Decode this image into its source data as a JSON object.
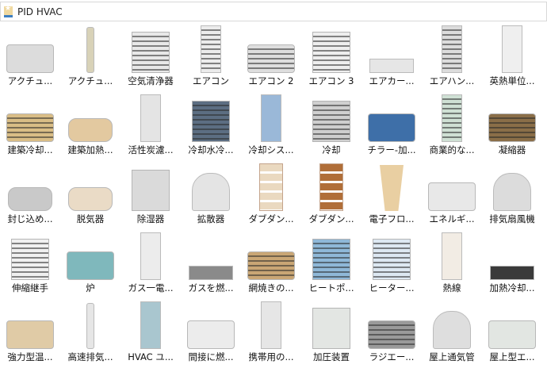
{
  "panel": {
    "title": "PID HVAC",
    "icon": "library-star-icon"
  },
  "items": [
    {
      "label": "アクチュ...",
      "icon": "actuator-icon",
      "shape": "wide",
      "color": "#dcdcdc"
    },
    {
      "label": "アクチュ...",
      "icon": "actuator-rod-icon",
      "shape": "thin",
      "color": "#d8d2b8"
    },
    {
      "label": "空気清浄器",
      "icon": "air-purifier-icon",
      "shape": "square",
      "color": "#e8e8e8",
      "stripes": true
    },
    {
      "label": "エアコン",
      "icon": "air-conditioner-tower-icon",
      "shape": "tall",
      "color": "#ececec",
      "stripes": true
    },
    {
      "label": "エアコン 2",
      "icon": "window-air-conditioner-icon",
      "shape": "wide",
      "color": "#dedede",
      "stripes": true
    },
    {
      "label": "エアコン 3",
      "icon": "wall-air-conditioner-icon",
      "shape": "square",
      "color": "#eeeeee",
      "stripes": true
    },
    {
      "label": "エアカー...",
      "icon": "air-curtain-icon",
      "shape": "strip",
      "color": "#e6e6e6"
    },
    {
      "label": "エアハン...",
      "icon": "air-handler-icon",
      "shape": "tall",
      "color": "#dcdcdc",
      "stripes": true
    },
    {
      "label": "英熱単位...",
      "icon": "btu-meter-icon",
      "shape": "tall",
      "color": "#efefef"
    },
    {
      "label": "建築冷却...",
      "icon": "building-cooling-icon",
      "shape": "wide",
      "color": "#d9bd86",
      "stripes": true
    },
    {
      "label": "建築加熱...",
      "icon": "building-heating-icon",
      "shape": "cyl",
      "color": "#e3c9a0"
    },
    {
      "label": "活性炭濾...",
      "icon": "carbon-filter-icon",
      "shape": "tall",
      "color": "#e4e4e4"
    },
    {
      "label": "冷却水冷...",
      "icon": "chilled-water-coil-icon",
      "shape": "square",
      "color": "#5c6e82",
      "stripes": true
    },
    {
      "label": "冷却シス...",
      "icon": "cooling-system-icon",
      "shape": "tall",
      "color": "#9ab8d8"
    },
    {
      "label": "冷却",
      "icon": "cooling-unit-icon",
      "shape": "square",
      "color": "#cfcfcf",
      "stripes": true
    },
    {
      "label": "チラー-加...",
      "icon": "chiller-icon",
      "shape": "wide",
      "color": "#3e6fa8"
    },
    {
      "label": "商業的な...",
      "icon": "commercial-unit-icon",
      "shape": "tall",
      "color": "#cfe0d4",
      "stripes": true
    },
    {
      "label": "凝縮器",
      "icon": "condenser-icon",
      "shape": "wide",
      "color": "#8a6e48",
      "stripes": true
    },
    {
      "label": "封じ込め...",
      "icon": "containment-icon",
      "shape": "cyl",
      "color": "#c9c9c9"
    },
    {
      "label": "脱気器",
      "icon": "deaerator-icon",
      "shape": "cyl",
      "color": "#eadbc6"
    },
    {
      "label": "除湿器",
      "icon": "dehumidifier-icon",
      "shape": "square",
      "color": "#dadada"
    },
    {
      "label": "拡散器",
      "icon": "diffuser-icon",
      "shape": "dome",
      "color": "#e4e4e4"
    },
    {
      "label": "ダブダン...",
      "icon": "damper-light-icon",
      "shape": "panel",
      "color": "#ead9c0",
      "wstripes": true
    },
    {
      "label": "ダブダン...",
      "icon": "damper-dark-icon",
      "shape": "panel",
      "color": "#b06e38",
      "wstripes": true
    },
    {
      "label": "電子フロ...",
      "icon": "electronic-flow-icon",
      "shape": "cone",
      "color": "#e9cfa2"
    },
    {
      "label": "エネルギ...",
      "icon": "energy-recovery-icon",
      "shape": "wide",
      "color": "#e8e8e8"
    },
    {
      "label": "排気扇風機",
      "icon": "exhaust-fan-icon",
      "shape": "dome",
      "color": "#dcdcdc"
    },
    {
      "label": "伸縮継手",
      "icon": "expansion-joint-icon",
      "shape": "square",
      "color": "#f0f0f0",
      "stripes": true
    },
    {
      "label": "炉",
      "icon": "furnace-icon",
      "shape": "wide",
      "color": "#7fb8bc"
    },
    {
      "label": "ガス一電...",
      "icon": "gas-electric-icon",
      "shape": "tall",
      "color": "#ececec"
    },
    {
      "label": "ガスを燃...",
      "icon": "gas-burner-icon",
      "shape": "strip",
      "color": "#8a8a8a"
    },
    {
      "label": "網焼きの...",
      "icon": "grill-icon",
      "shape": "wide",
      "color": "#c9a675",
      "stripes": true
    },
    {
      "label": "ヒートポ...",
      "icon": "heat-pump-icon",
      "shape": "square",
      "color": "#8fb8d8",
      "stripes": true
    },
    {
      "label": "ヒーター...",
      "icon": "heater-icon",
      "shape": "square",
      "color": "#dde8f2",
      "stripes": true
    },
    {
      "label": "熱線",
      "icon": "heat-wire-icon",
      "shape": "tall",
      "color": "#f2ece4"
    },
    {
      "label": "加熱冷却...",
      "icon": "heating-cooling-icon",
      "shape": "strip",
      "color": "#3a3a3a"
    },
    {
      "label": "強力型温...",
      "icon": "water-heater-icon",
      "shape": "wide",
      "color": "#e0cba6"
    },
    {
      "label": "高速排気...",
      "icon": "high-speed-exhaust-icon",
      "shape": "thin",
      "color": "#e6e6e6"
    },
    {
      "label": "HVAC ユ...",
      "icon": "hvac-unit-icon",
      "shape": "tall",
      "color": "#a9c6cf"
    },
    {
      "label": "間接に燃...",
      "icon": "indirect-fired-icon",
      "shape": "wide",
      "color": "#ececec"
    },
    {
      "label": "携帯用の...",
      "icon": "portable-unit-icon",
      "shape": "tall",
      "color": "#e6e6e6"
    },
    {
      "label": "加圧装置",
      "icon": "pressurizer-icon",
      "shape": "square",
      "color": "#e3e6e3"
    },
    {
      "label": "ラジエー...",
      "icon": "radiator-icon",
      "shape": "wide",
      "color": "#9a9a9a",
      "stripes": true
    },
    {
      "label": "屋上通気管",
      "icon": "roof-vent-icon",
      "shape": "dome",
      "color": "#dedede"
    },
    {
      "label": "屋上型エ...",
      "icon": "rooftop-unit-icon",
      "shape": "wide",
      "color": "#e2e6e2"
    }
  ]
}
